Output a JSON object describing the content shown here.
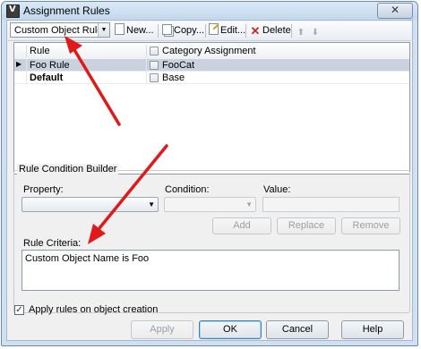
{
  "window": {
    "title": "Assignment Rules",
    "close_glyph": "✕"
  },
  "toolbar": {
    "rule_set_value": "Custom Object Rules",
    "new_label": "New...",
    "copy_label": "Copy...",
    "edit_label": "Edit...",
    "delete_label": "Delete",
    "delete_glyph": "✕",
    "move_up_glyph": "⬆",
    "move_down_glyph": "⬇"
  },
  "grid": {
    "columns": [
      "Rule",
      "Category Assignment"
    ],
    "rows": [
      {
        "rule": "Foo Rule",
        "category": "FooCat",
        "selected": true,
        "bold": false
      },
      {
        "rule": "Default",
        "category": "Base",
        "selected": false,
        "bold": true
      }
    ]
  },
  "builder": {
    "group_title": "Rule Condition Builder",
    "property_label": "Property:",
    "condition_label": "Condition:",
    "value_label": "Value:",
    "add_label": "Add",
    "replace_label": "Replace",
    "remove_label": "Remove",
    "criteria_label": "Rule Criteria:",
    "criteria_text": "Custom Object Name is Foo"
  },
  "footer": {
    "apply_on_creation_label": "Apply rules on object creation",
    "apply_on_creation_checked": true,
    "apply_label": "Apply",
    "ok_label": "OK",
    "cancel_label": "Cancel",
    "help_label": "Help"
  },
  "colors": {
    "annotation_arrow": "#e0191b",
    "selected_row": "#c9d2de"
  }
}
